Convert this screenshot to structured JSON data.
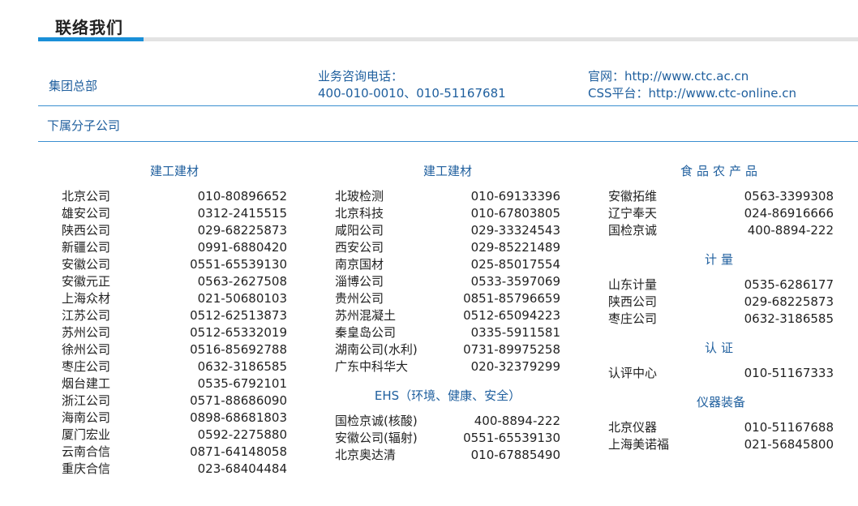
{
  "page": {
    "title": "联络我们"
  },
  "hq": {
    "label": "集团总部",
    "hotline_label": "业务咨询电话：",
    "hotline_numbers": "400-010-0010、010-51167681",
    "website": "官网：http://www.ctc.ac.cn",
    "css_platform": "CSS平台：http://www.ctc-online.cn"
  },
  "subsidiaries": {
    "label": "下属分子公司"
  },
  "columns": [
    {
      "sections": [
        {
          "category": "建工建材",
          "entries": [
            {
              "name": "北京公司",
              "phone": "010-80896652"
            },
            {
              "name": "雄安公司",
              "phone": "0312-2415515"
            },
            {
              "name": "陕西公司",
              "phone": "029-68225873"
            },
            {
              "name": "新疆公司",
              "phone": "0991-6880420"
            },
            {
              "name": "安徽公司",
              "phone": "0551-65539130"
            },
            {
              "name": "安徽元正",
              "phone": "0563-2627508"
            },
            {
              "name": "上海众材",
              "phone": "021-50680103"
            },
            {
              "name": "江苏公司",
              "phone": "0512-62513873"
            },
            {
              "name": "苏州公司",
              "phone": "0512-65332019"
            },
            {
              "name": "徐州公司",
              "phone": "0516-85692788"
            },
            {
              "name": "枣庄公司",
              "phone": "0632-3186585"
            },
            {
              "name": "烟台建工",
              "phone": "0535-6792101"
            },
            {
              "name": "浙江公司",
              "phone": "0571-88686090"
            },
            {
              "name": "海南公司",
              "phone": "0898-68681803"
            },
            {
              "name": "厦门宏业",
              "phone": "0592-2275880"
            },
            {
              "name": "云南合信",
              "phone": "0871-64148058"
            },
            {
              "name": "重庆合信",
              "phone": "023-68404484"
            }
          ]
        }
      ]
    },
    {
      "sections": [
        {
          "category": "建工建材",
          "entries": [
            {
              "name": "北玻检测",
              "phone": "010-69133396"
            },
            {
              "name": "北京科技",
              "phone": "010-67803805"
            },
            {
              "name": "咸阳公司",
              "phone": "029-33324543"
            },
            {
              "name": "西安公司",
              "phone": "029-85221489"
            },
            {
              "name": "南京国材",
              "phone": "025-85017554"
            },
            {
              "name": "淄博公司",
              "phone": "0533-3597069"
            },
            {
              "name": "贵州公司",
              "phone": "0851-85796659"
            },
            {
              "name": "苏州混凝土",
              "phone": "0512-65094223"
            },
            {
              "name": "秦皇岛公司",
              "phone": "0335-5911581"
            },
            {
              "name": "湖南公司(水利)",
              "phone": "0731-89975258"
            },
            {
              "name": "广东中科华大",
              "phone": "020-32379299"
            }
          ]
        },
        {
          "category": "EHS（环境、健康、安全）",
          "entries": [
            {
              "name": "国检京诚(核酸)",
              "phone": "400-8894-222"
            },
            {
              "name": "安徽公司(辐射)",
              "phone": "0551-65539130"
            },
            {
              "name": "北京奥达清",
              "phone": "010-67885490"
            }
          ]
        }
      ]
    },
    {
      "sections": [
        {
          "category": "食品农产品",
          "entries": [
            {
              "name": "安徽拓维",
              "phone": "0563-3399308"
            },
            {
              "name": "辽宁奉天",
              "phone": "024-86916666"
            },
            {
              "name": "国检京诚",
              "phone": "400-8894-222"
            }
          ]
        },
        {
          "category": "计量",
          "entries": [
            {
              "name": "山东计量",
              "phone": "0535-6286177"
            },
            {
              "name": "陕西公司",
              "phone": "029-68225873"
            },
            {
              "name": "枣庄公司",
              "phone": "0632-3186585"
            }
          ]
        },
        {
          "category": "认证",
          "entries": [
            {
              "name": "认评中心",
              "phone": "010-51167333"
            }
          ]
        },
        {
          "category": "仪器装备",
          "entries": [
            {
              "name": "北京仪器",
              "phone": "010-51167688"
            },
            {
              "name": "上海美诺福",
              "phone": "021-56845800"
            }
          ]
        }
      ]
    }
  ]
}
